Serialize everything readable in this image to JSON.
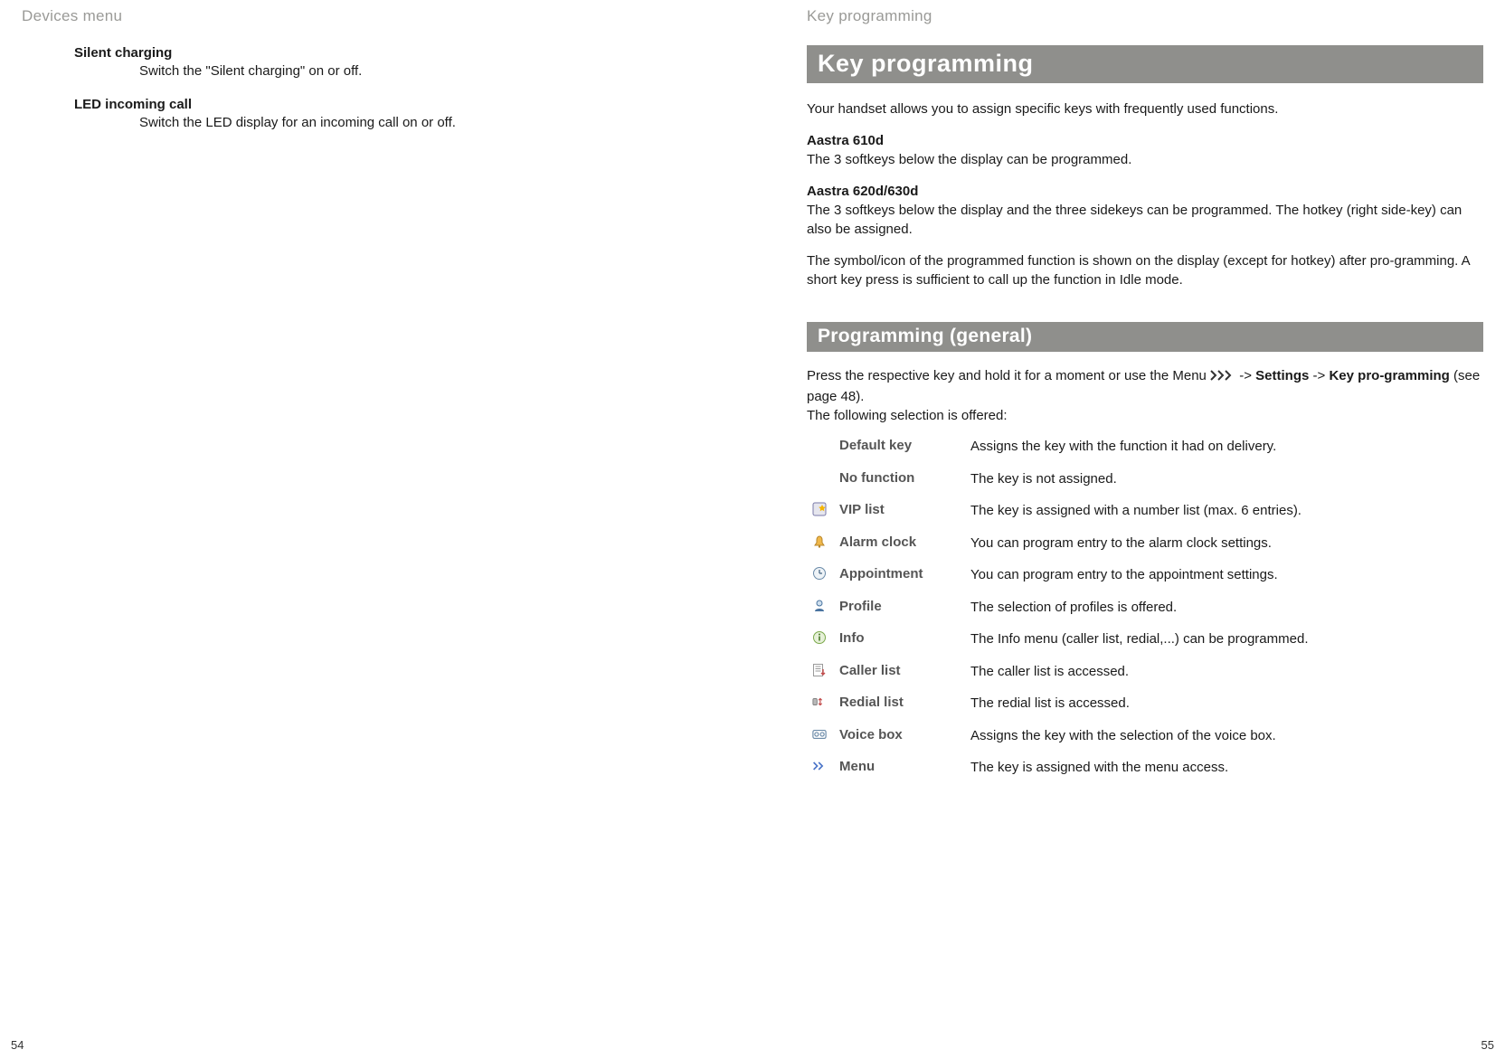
{
  "left": {
    "runningHeader": "Devices menu",
    "pageNumber": "54",
    "items": [
      {
        "head": "Silent charging",
        "body": "Switch the \"Silent charging\" on or off."
      },
      {
        "head": "LED incoming call",
        "body": "Switch the LED display for an incoming call on or off."
      }
    ]
  },
  "right": {
    "runningHeader": "Key programming",
    "pageNumber": "55",
    "titleBar": "Key programming",
    "intro": "Your handset allows you to assign specific keys with frequently used functions.",
    "blocks": [
      {
        "head": "Aastra 610d",
        "body": "The 3 softkeys below the display can be programmed."
      },
      {
        "head": "Aastra 620d/630d",
        "body": "The 3 softkeys below the display and the three sidekeys can be programmed. The hotkey (right side-key) can also be assigned."
      }
    ],
    "note": "The symbol/icon of the programmed function is shown on the display (except for hotkey) after pro-gramming. A short key press is sufficient to call up the function in Idle mode.",
    "subBar": "Programming (general)",
    "press1": "Press the respective key and hold it for a moment or use the Menu ",
    "pressArrow": "->",
    "pressSettings": "Settings",
    "pressKeyProg": "Key pro-gramming",
    "pressPage": " (see page 48).",
    "offered": "The following selection is offered:",
    "options": [
      {
        "icon": "",
        "name": "Default key",
        "desc": "Assigns the key with the function it had on delivery."
      },
      {
        "icon": "",
        "name": "No function",
        "desc": "The key is not assigned."
      },
      {
        "icon": "vip-icon",
        "name": "VIP list",
        "desc": "The key is assigned with a number list (max. 6 entries)."
      },
      {
        "icon": "alarm-icon",
        "name": "Alarm clock",
        "desc": "You can program entry to the alarm clock settings."
      },
      {
        "icon": "appt-icon",
        "name": "Appointment",
        "desc": "You can program entry to the appointment settings."
      },
      {
        "icon": "profile-icon",
        "name": "Profile",
        "desc": "The selection of profiles is offered."
      },
      {
        "icon": "info-icon",
        "name": "Info",
        "desc": "The Info menu (caller list, redial,...) can be programmed."
      },
      {
        "icon": "caller-icon",
        "name": "Caller list",
        "desc": "The caller list is accessed."
      },
      {
        "icon": "redial-icon",
        "name": "Redial list",
        "desc": "The redial list is accessed."
      },
      {
        "icon": "voice-icon",
        "name": "Voice box",
        "desc": "Assigns the key with the selection of the voice box."
      },
      {
        "icon": "menu-icon",
        "name": "Menu",
        "desc": "The key is assigned with the menu access."
      }
    ]
  }
}
